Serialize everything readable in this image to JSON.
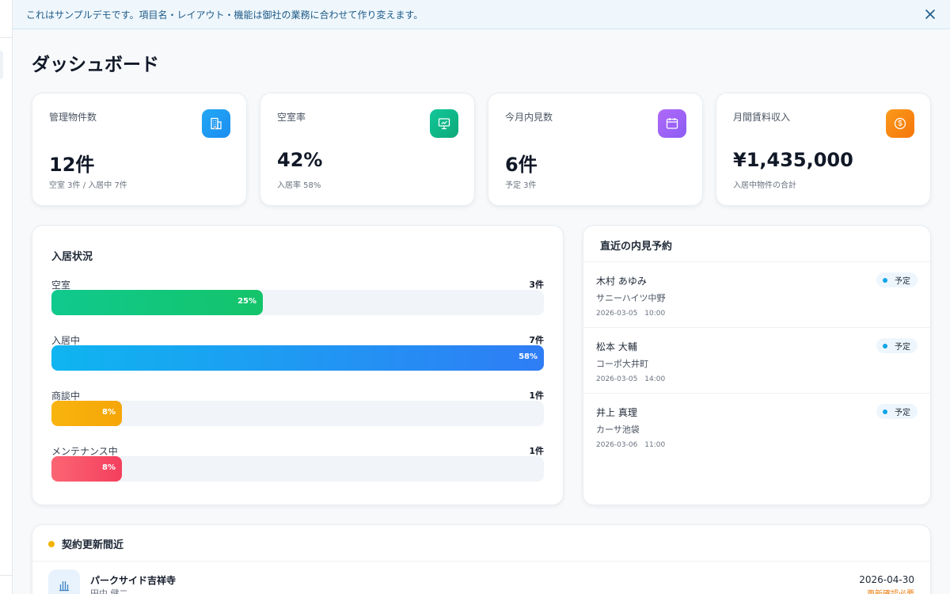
{
  "banner": {
    "text": "これはサンプルデモです。項目名・レイアウト・機能は御社の業務に合わせて作り変えます。"
  },
  "page_title": "ダッシュボード",
  "stats": [
    {
      "label": "管理物件数",
      "value": "12件",
      "sub": "空室 3件 / 入居中 7件",
      "icon": "building-icon",
      "color": "#1d9bf0"
    },
    {
      "label": "空室率",
      "value": "42%",
      "sub": "入居率 58%",
      "icon": "chart-board-icon",
      "color": "#10b981"
    },
    {
      "label": "今月内見数",
      "value": "6件",
      "sub": "予定 3件",
      "icon": "calendar-icon",
      "color": "#9d5cf5"
    },
    {
      "label": "月間賃料収入",
      "value": "¥1,435,000",
      "sub": "入居中物件の合計",
      "icon": "coin-icon",
      "color": "#f97316"
    }
  ],
  "occupancy": {
    "title": "入居状況",
    "rows": [
      {
        "label": "空室",
        "count": "3件",
        "pct": "25%",
        "fraction": 0.43,
        "from": "#10c98d",
        "to": "#14c46a"
      },
      {
        "label": "入居中",
        "count": "7件",
        "pct": "58%",
        "fraction": 1.0,
        "from": "#0fb5f0",
        "to": "#2f7df5"
      },
      {
        "label": "商談中",
        "count": "1件",
        "pct": "8%",
        "fraction": 0.143,
        "from": "#f8b40f",
        "to": "#f5a607"
      },
      {
        "label": "メンテナンス中",
        "count": "1件",
        "pct": "8%",
        "fraction": 0.143,
        "from": "#fb6573",
        "to": "#f43f5e"
      }
    ]
  },
  "visits": {
    "title": "直近の内見予約",
    "items": [
      {
        "name": "木村 あゆみ",
        "property": "サニーハイツ中野",
        "datetime": "2026-03-05　10:00",
        "status": "予定"
      },
      {
        "name": "松本 大輔",
        "property": "コーポ大井町",
        "datetime": "2026-03-05　14:00",
        "status": "予定"
      },
      {
        "name": "井上 真理",
        "property": "カーサ池袋",
        "datetime": "2026-03-06　11:00",
        "status": "予定"
      }
    ]
  },
  "renewals": {
    "title": "契約更新間近",
    "items": [
      {
        "name": "パークサイド吉祥寺",
        "owner": "田中 健二",
        "date": "2026-04-30",
        "status": "更新確認必要"
      }
    ]
  }
}
